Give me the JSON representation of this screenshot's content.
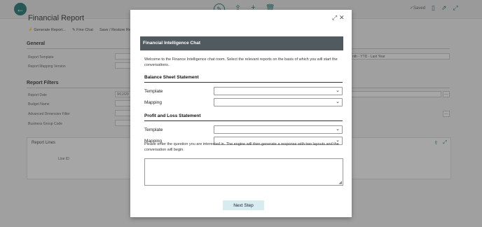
{
  "topbar": {
    "saved": "✓Saved"
  },
  "page": {
    "title": "Financial Report"
  },
  "actions": [
    {
      "label": "Generate Report..."
    },
    {
      "label": "Fine Chat"
    },
    {
      "label": "Save / Restore Report"
    }
  ],
  "general": {
    "heading": "General",
    "report_template_label": "Report Template",
    "report_mapping_label": "Report Mapping Version",
    "right_value": "nth - YTD - Last Year"
  },
  "filters": {
    "heading": "Report Filters",
    "report_date_label": "Report Date",
    "report_date_value": "9/12/20",
    "budget_label": "Budget Name",
    "dimension_label": "Advanced Dimension Filter",
    "business_group_label": "Business Group Code"
  },
  "lines": {
    "title": "Report Lines",
    "col_line_id": "Line ID"
  },
  "modal": {
    "title": "Financial Intelligence Chat",
    "intro": "Welcome to the Finance Intelligence chat room. Select the relevant reports on the basis of which you will start the conversations.",
    "balance_heading": "Balance Sheet Statement",
    "pl_heading": "Profit and Loss Statement",
    "template_label": "Template",
    "mapping_label": "Mapping",
    "balance_template_value": "",
    "balance_mapping_value": "",
    "pl_template_value": "",
    "pl_mapping_value": "",
    "question_prompt": "Please enter the question you are interested in. The engine will then generate a response with two layouts and the conversation will begin.",
    "question_value": "",
    "next_label": "Next Step"
  }
}
